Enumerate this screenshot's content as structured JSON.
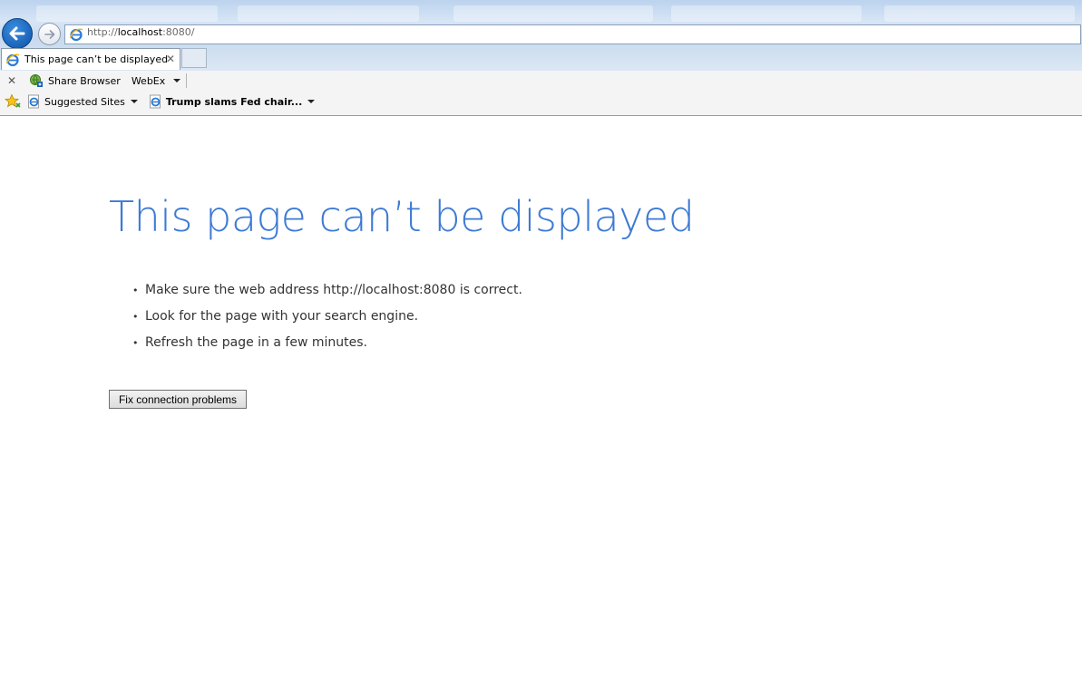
{
  "browser": {
    "address": {
      "prefix": "http://",
      "host": "localhost",
      "suffix": ":8080/"
    },
    "tab": {
      "title": "This page can’t be displayed",
      "close_glyph": "✕"
    },
    "command_bar": {
      "close_glyph": "✕",
      "share_browser": "Share Browser",
      "webex": "WebEx"
    },
    "favorites_bar": {
      "suggested_sites": "Suggested Sites",
      "news_item": "Trump slams Fed chair..."
    },
    "colors": {
      "accent_blue": "#3d7ad4",
      "back_button": "#1a63b8"
    },
    "icons": [
      "back-arrow-icon",
      "forward-arrow-icon",
      "ie-page-icon",
      "share-browser-icon",
      "favorites-star-icon",
      "chevron-down-icon",
      "close-icon"
    ]
  },
  "page": {
    "title": "This page can’t be displayed",
    "suggestions": [
      "Make sure the web address http://localhost:8080 is correct.",
      "Look for the page with your search engine.",
      "Refresh the page in a few minutes."
    ],
    "fix_button": "Fix connection problems"
  }
}
